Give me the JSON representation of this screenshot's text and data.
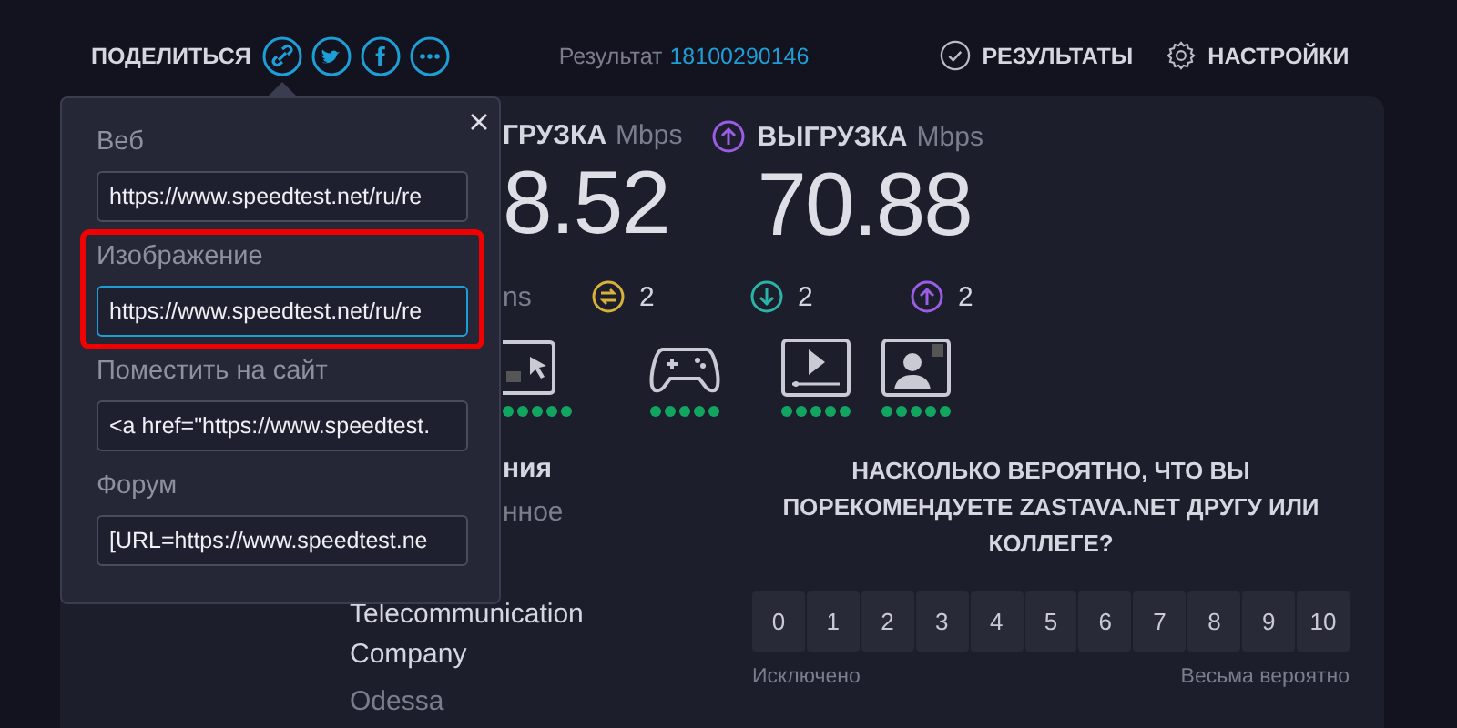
{
  "header": {
    "share_label": "ПОДЕЛИТЬСЯ",
    "share_buttons": [
      {
        "kind": "link"
      },
      {
        "kind": "twitter"
      },
      {
        "kind": "facebook"
      },
      {
        "kind": "more"
      }
    ],
    "result_label": "Результат",
    "result_id": "18100290146",
    "nav": [
      {
        "kind": "results",
        "label": "РЕЗУЛЬТАТЫ"
      },
      {
        "kind": "settings",
        "label": "НАСТРОЙКИ"
      }
    ]
  },
  "share_popup": {
    "fields": [
      {
        "label": "Веб",
        "value": "https://www.speedtest.net/ru/re",
        "focused": false,
        "highlighted": false
      },
      {
        "label": "Изображение",
        "value": "https://www.speedtest.net/ru/re",
        "focused": true,
        "highlighted": true
      },
      {
        "label": "Поместить на сайт",
        "value": "<a href=\"https://www.speedtest.",
        "focused": false,
        "highlighted": false
      },
      {
        "label": "Форум",
        "value": "[URL=https://www.speedtest.ne",
        "focused": false,
        "highlighted": false
      }
    ]
  },
  "speeds": [
    {
      "kind": "download",
      "label": "ГРУЗКА",
      "unit": "Mbps",
      "value": "8.52"
    },
    {
      "kind": "upload",
      "label": "ВЫГРУЗКА",
      "unit": "Mbps",
      "value": "70.88"
    }
  ],
  "stats": [
    {
      "kind": "cut",
      "text": "ns"
    },
    {
      "kind": "jitter",
      "text": "2"
    },
    {
      "kind": "download",
      "text": "2"
    },
    {
      "kind": "upload",
      "text": "2"
    }
  ],
  "activities": [
    {
      "kind": "browsing",
      "stars": 5
    },
    {
      "kind": "gaming",
      "stars": 5
    },
    {
      "kind": "video",
      "stars": 5
    },
    {
      "kind": "videocall",
      "stars": 5
    }
  ],
  "provider": {
    "title": "ния",
    "subtitle": "нное",
    "isp": "Telecommunication Company",
    "city": "Odessa"
  },
  "survey": {
    "question": "НАСКОЛЬКО ВЕРОЯТНО, ЧТО ВЫ ПОРЕКОМЕНДУЕТЕ ZASTAVA.NET ДРУГУ ИЛИ КОЛЛЕГЕ?",
    "scale": [
      "0",
      "1",
      "2",
      "3",
      "4",
      "5",
      "6",
      "7",
      "8",
      "9",
      "10"
    ],
    "low_label": "Исключено",
    "high_label": "Весьма вероятно"
  }
}
